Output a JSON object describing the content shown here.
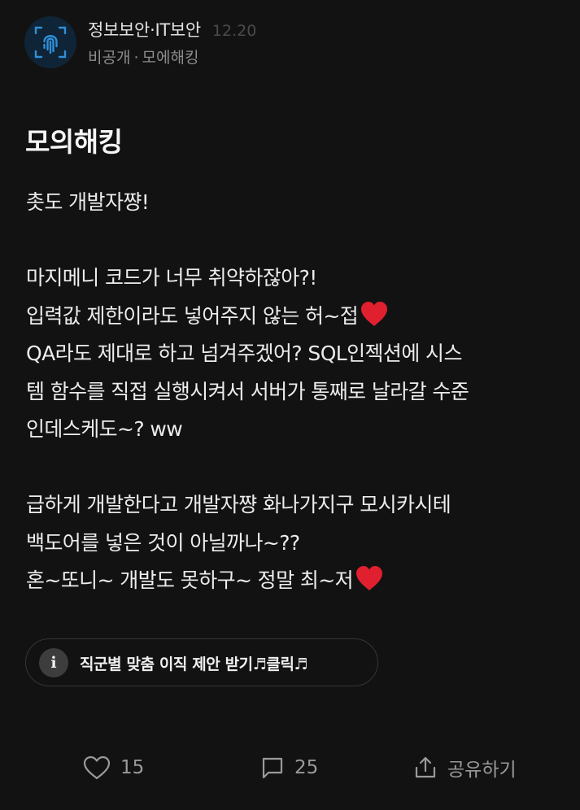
{
  "post": {
    "author": "정보보안·IT보안",
    "date": "12.20",
    "visibility": "비공개",
    "meta_separator": "·",
    "category": "모에해킹",
    "title": "모의해킹",
    "body_lines": [
      "촛도 개발자쨩!",
      "",
      "마지메니  코드가 너무 취약하잖아?!",
      "입력값 제한이라도 넣어주지 않는 허~접",
      "QA라도 제대로 하고 넘겨주겠어? SQL인젝션에 시스",
      "템 함수를 직접 실행시켜서 서버가 통째로 날라갈 수준",
      "인데스케도~? ww",
      "",
      "급하게 개발한다고 개발자쨩 화나가지구 모시카시테",
      "백도어를 넣은 것이 아닐까나~??",
      "혼~또니~ 개발도 못하구~ 정말 최~저"
    ]
  },
  "promo": {
    "info_symbol": "i",
    "label": "직군별 맞춤 이직 제안 받기♬클릭♬"
  },
  "actions": {
    "like_count": "15",
    "comment_count": "25",
    "share_label": "공유하기"
  },
  "icons": {
    "avatar": "fingerprint-icon",
    "heart_emoji": "red-heart-icon",
    "like": "heart-outline-icon",
    "comment": "chat-bubble-icon",
    "share": "share-icon",
    "info": "info-icon"
  },
  "colors": {
    "background": "#121212",
    "text": "#ececec",
    "muted": "#8c8c8c",
    "avatar_bg": "#0f2436",
    "avatar_accent": "#2f8fd8",
    "heart": "#e0202f"
  }
}
